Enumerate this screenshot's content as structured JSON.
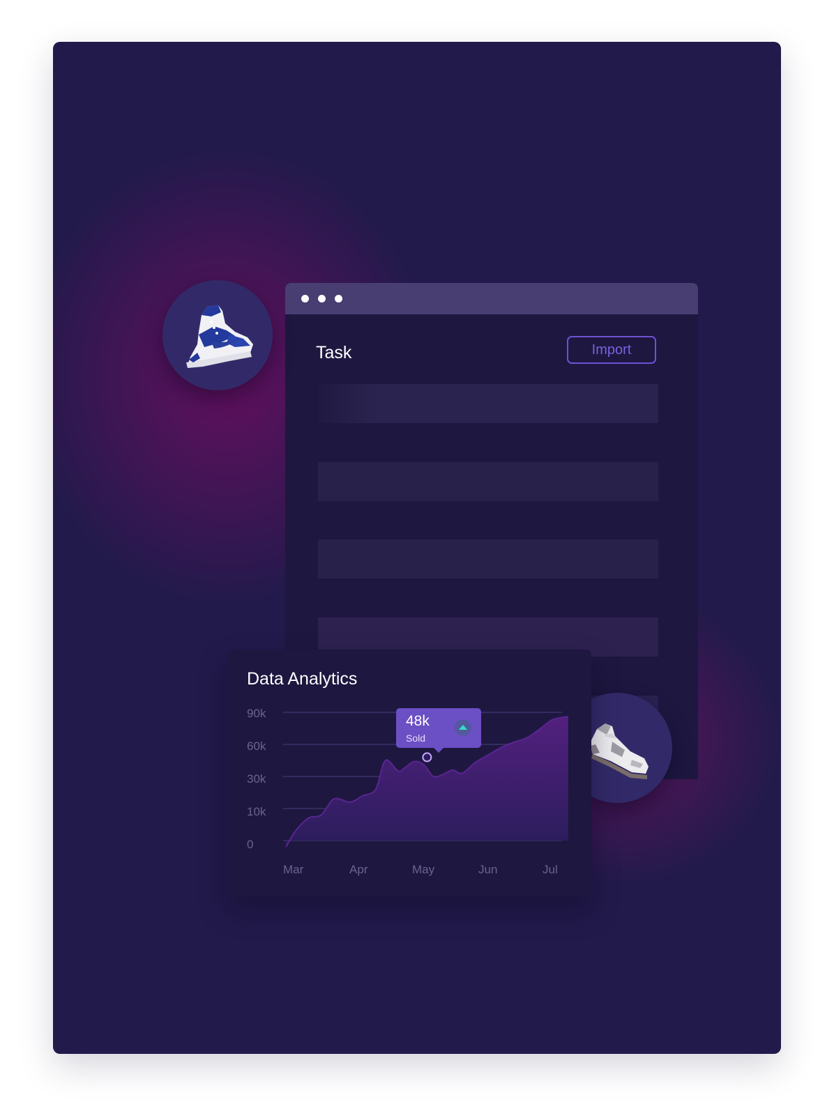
{
  "window": {
    "title": "Task",
    "import_label": "Import"
  },
  "analytics": {
    "title": "Data Analytics",
    "tooltip": {
      "value": "48k",
      "label": "Sold"
    }
  },
  "avatars": [
    {
      "name": "blue-high-top-sneaker"
    },
    {
      "name": "white-grey-sneaker"
    }
  ],
  "colors": {
    "background": "#221a4b",
    "accent": "#6b4fc4",
    "import_border": "#6d52d6",
    "up_indicator": "#2ee0c8"
  },
  "chart_data": {
    "type": "area",
    "title": "Data Analytics",
    "y_tick_labels": [
      "0",
      "10k",
      "30k",
      "60k",
      "90k"
    ],
    "y_tick_values": [
      0,
      10000,
      30000,
      60000,
      90000
    ],
    "x_tick_labels": [
      "Mar",
      "Apr",
      "May",
      "Jun",
      "Jul"
    ],
    "x": [
      0,
      0.15,
      0.35,
      0.55,
      0.75,
      1.0,
      1.2,
      1.4,
      1.55,
      1.75,
      1.85,
      2.0,
      2.15,
      2.3,
      2.45,
      2.6,
      2.75,
      2.95,
      3.15,
      3.35,
      3.55,
      3.75,
      3.95,
      4.15,
      4.4
    ],
    "series": [
      {
        "values": [
          -2000,
          3000,
          7000,
          8000,
          16000,
          14000,
          18000,
          22000,
          45000,
          35000,
          38000,
          44000,
          41000,
          30000,
          32000,
          36000,
          33000,
          43000,
          50000,
          57000,
          62000,
          66000,
          74000,
          83000,
          86000
        ]
      }
    ],
    "highlight": {
      "x_label": "May",
      "value": "48k",
      "label": "Sold"
    },
    "grid": true,
    "legend": "none"
  }
}
